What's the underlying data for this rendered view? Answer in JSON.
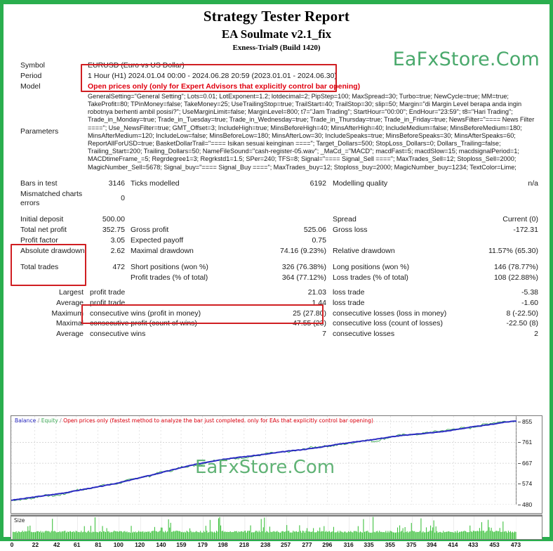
{
  "header": {
    "title": "Strategy Tester Report",
    "ea_name": "EA Soulmate v2.1_fix",
    "broker": "Exness-Trial9 (Build 1420)",
    "brand": "EaFxStore.Com",
    "brand_color": "#4aa96c"
  },
  "info": {
    "symbol_label": "Symbol",
    "symbol_value": "EURUSD (Euro vs US Dollar)",
    "period_label": "Period",
    "period_value": "1 Hour (H1) 2024.01.04 00:00 - 2024.06.28 20:59 (2023.01.01 - 2024.06.30)",
    "model_label": "Model",
    "model_value": "Open prices only (only for Expert Advisors that explicitly control bar opening)",
    "model_color": "#e0000f",
    "parameters_label": "Parameters",
    "parameters_value": "GeneralSetting=\"General Setting\"; Lots=0.01; LotExponent=1.2; lotdecimal=2; PipStep=100; MaxSpread=30; Turbo=true; NewCycle=true; MM=true; TakeProfit=80; TPinMoney=false; TakeMoney=25; UseTrailingStop=true; TrailStart=40; TrailStop=30; slip=50; Margin=\"di Margin Level berapa anda ingin robotnya berhenti ambil posisi?\"; UseMarginLimit=false; MarginLevel=800; t7=\"Jam Trading\"; StartHour=\"00:00\"; EndHour=\"23:59\"; t8=\"Hari Trading\"; Trade_in_Monday=true; Trade_in_Tuesday=true; Trade_in_Wednesday=true; Trade_in_Thursday=true; Trade_in_Friday=true; NewsFilter=\"==== News Filter ====\"; Use_NewsFilter=true; GMT_Offset=3; IncludeHigh=true; MinsBeforeHigh=40; MinsAfterHigh=40; IncludeMedium=false; MinsBeforeMedium=180; MinsAfterMedium=120; IncludeLow=false; MinsBeforeLow=180; MinsAfterLow=30; IncludeSpeaks=true; MinsBeforeSpeaks=30; MinsAfterSpeaks=60; ReportAllForUSD=true; BasketDollarTrail=\"==== Isikan sesuai keinginan ====\"; Target_Dollars=500; StopLoss_Dollars=0; Dollars_Trailing=false; Trailing_Start=200; Trailing_Dollars=50; NameFileSound=\"cash-register-05.wav\"; _MaCd_=\"MACD\"; macdFast=5; macdSlow=15; macdsignalPeriod=1; MACDtimeFrame_=5; Regrdegree1=3; Regrkstd1=1.5; SPer=240; TFS=8; Signal=\"==== Signal_Sell ====\"; MaxTrades_Sell=12; Stoploss_Sell=2000; MagicNumber_Sell=5678; Signal_buy=\"==== Signal_Buy ====\"; MaxTrades_buy=12; Stoploss_buy=2000; MagicNumber_buy=1234; TextColor=Lime;"
  },
  "stats": {
    "bars_in_test_label": "Bars in test",
    "bars_in_test_value": "3146",
    "ticks_modelled_label": "Ticks modelled",
    "ticks_modelled_value": "6192",
    "modelling_quality_label": "Modelling quality",
    "modelling_quality_value": "n/a",
    "mismatched_label": "Mismatched charts errors",
    "mismatched_value": "0",
    "initial_deposit_label": "Initial deposit",
    "initial_deposit_value": "500.00",
    "spread_label": "Spread",
    "spread_value": "Current (0)",
    "total_net_profit_label": "Total net profit",
    "total_net_profit_value": "352.75",
    "gross_profit_label": "Gross profit",
    "gross_profit_value": "525.06",
    "gross_loss_label": "Gross loss",
    "gross_loss_value": "-172.31",
    "profit_factor_label": "Profit factor",
    "profit_factor_value": "3.05",
    "expected_payoff_label": "Expected payoff",
    "expected_payoff_value": "0.75",
    "absolute_drawdown_label": "Absolute drawdown",
    "absolute_drawdown_value": "2.62",
    "maximal_drawdown_label": "Maximal drawdown",
    "maximal_drawdown_value": "74.16 (9.23%)",
    "relative_drawdown_label": "Relative drawdown",
    "relative_drawdown_value": "11.57% (65.30)",
    "total_trades_label": "Total trades",
    "total_trades_value": "472",
    "short_positions_label": "Short positions (won %)",
    "short_positions_value": "326 (76.38%)",
    "long_positions_label": "Long positions (won %)",
    "long_positions_value": "146 (78.77%)",
    "profit_trades_label": "Profit trades (% of total)",
    "profit_trades_value": "364 (77.12%)",
    "loss_trades_label": "Loss trades (% of total)",
    "loss_trades_value": "108 (22.88%)",
    "largest_label": "Largest",
    "largest_profit_trade_label": "profit trade",
    "largest_profit_trade_value": "21.03",
    "largest_loss_trade_label": "loss trade",
    "largest_loss_trade_value": "-5.38",
    "average_label": "Average",
    "average_profit_trade_label": "profit trade",
    "average_profit_trade_value": "1.44",
    "average_loss_trade_label": "loss trade",
    "average_loss_trade_value": "-1.60",
    "maximum_label": "Maximum",
    "max_consecutive_wins_label": "consecutive wins (profit in money)",
    "max_consecutive_wins_value": "25 (27.80)",
    "max_consecutive_losses_label": "consecutive losses (loss in money)",
    "max_consecutive_losses_value": "8 (-22.50)",
    "maximal_label": "Maximal",
    "maximal_consecutive_profit_label": "consecutive profit (count of wins)",
    "maximal_consecutive_profit_value": "47.55 (23)",
    "maximal_consecutive_loss_label": "consecutive loss (count of losses)",
    "maximal_consecutive_loss_value": "-22.50 (8)",
    "average2_label": "Average",
    "avg_consecutive_wins_label": "consecutive wins",
    "avg_consecutive_wins_value": "7",
    "avg_consecutive_losses_label": "consecutive losses",
    "avg_consecutive_losses_value": "2"
  },
  "chart_data": {
    "type": "line",
    "title": "Balance / Equity / Open prices only (fastest method to analyze the bar just completed. only for EAs that explicitly control bar opening)",
    "legend": [
      {
        "name": "Balance",
        "color": "#2b2bc2"
      },
      {
        "name": "Equity",
        "color": "#3fae58"
      },
      {
        "name": "Open prices only (fastest method to analyze the bar just completed. only for EAs that explicitly control bar opening)",
        "color": "#e0000f"
      }
    ],
    "legend_position": "top-left",
    "grid": true,
    "watermark": "EaFxStore.Com",
    "xlabel": "",
    "ylabel": "",
    "ylim": [
      480,
      880
    ],
    "yticks": [
      855,
      761,
      667,
      574,
      480
    ],
    "xticks": [
      0,
      22,
      42,
      61,
      81,
      100,
      120,
      140,
      159,
      179,
      198,
      218,
      238,
      257,
      277,
      296,
      316,
      335,
      355,
      375,
      394,
      414,
      433,
      453,
      473
    ],
    "xlim": [
      0,
      473
    ],
    "series": [
      {
        "name": "Balance",
        "color": "#2b2bc2",
        "x": [
          0,
          10,
          20,
          30,
          40,
          50,
          60,
          70,
          80,
          90,
          100,
          110,
          120,
          130,
          140,
          150,
          160,
          170,
          180,
          190,
          200,
          210,
          220,
          230,
          240,
          250,
          260,
          270,
          280,
          290,
          300,
          310,
          320,
          330,
          340,
          350,
          360,
          370,
          380,
          390,
          400,
          410,
          420,
          430,
          440,
          450,
          460,
          472
        ],
        "values": [
          500,
          506,
          513,
          520,
          526,
          533,
          542,
          551,
          559,
          568,
          578,
          589,
          601,
          612,
          624,
          636,
          648,
          659,
          669,
          678,
          686,
          692,
          697,
          703,
          709,
          716,
          722,
          727,
          733,
          740,
          748,
          756,
          762,
          768,
          775,
          782,
          789,
          794,
          799,
          803,
          808,
          814,
          822,
          830,
          836,
          843,
          851,
          858
        ]
      },
      {
        "name": "Equity",
        "color": "#3fae58",
        "x": [
          0,
          10,
          20,
          30,
          40,
          50,
          60,
          70,
          80,
          90,
          100,
          110,
          120,
          130,
          140,
          150,
          160,
          170,
          180,
          190,
          200,
          210,
          220,
          230,
          240,
          250,
          260,
          270,
          280,
          290,
          300,
          310,
          320,
          330,
          340,
          350,
          360,
          370,
          380,
          390,
          400,
          410,
          420,
          430,
          440,
          450,
          460,
          472
        ],
        "values": [
          500,
          503,
          509,
          522,
          519,
          528,
          546,
          548,
          562,
          571,
          575,
          591,
          604,
          609,
          628,
          633,
          651,
          655,
          665,
          681,
          684,
          688,
          694,
          700,
          712,
          714,
          719,
          725,
          738,
          743,
          745,
          752,
          759,
          772,
          765,
          779,
          791,
          797,
          796,
          806,
          812,
          818,
          826,
          826,
          840,
          849,
          855,
          858
        ]
      }
    ],
    "size_subplot": {
      "label": "Size",
      "color": "#3ec13e",
      "type": "bar",
      "n_bars": 473
    }
  }
}
